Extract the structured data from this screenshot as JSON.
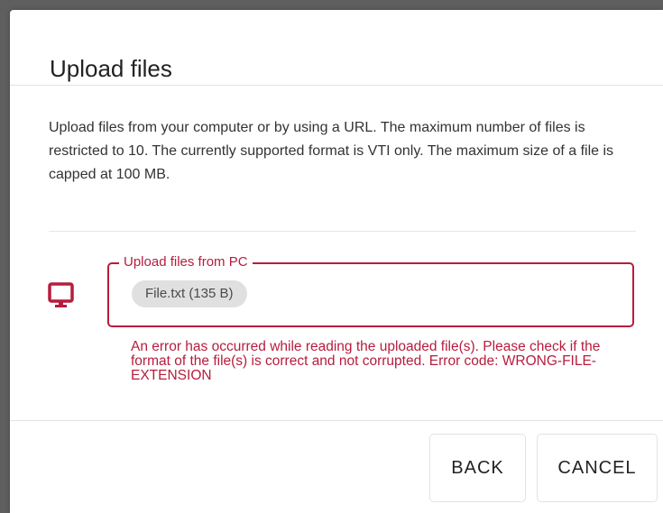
{
  "dialog": {
    "title": "Upload files",
    "description": "Upload files from your computer or by using a URL. The maximum number of files is restricted to 10. The currently supported format is VTI only. The maximum size of a file is capped at 100 MB."
  },
  "upload": {
    "source_icon": "monitor-icon",
    "legend": "Upload files from PC",
    "file_chip": "File.txt (135 B)",
    "error_message": "An error has occurred while reading the uploaded file(s). Please check if the format of the file(s) is correct and not corrupted. Error code: WRONG-FILE-EXTENSION"
  },
  "actions": {
    "back_label": "BACK",
    "cancel_label": "CANCEL"
  },
  "colors": {
    "error_accent": "#b71c3c",
    "chip_background": "#e0e0e0",
    "backdrop": "#5f5f5f"
  }
}
